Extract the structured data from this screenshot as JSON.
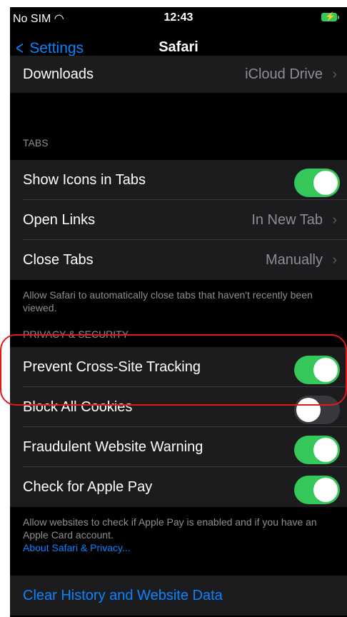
{
  "status": {
    "carrier": "No SIM",
    "time": "12:43"
  },
  "nav": {
    "back_label": "Settings",
    "title": "Safari"
  },
  "downloads": {
    "label": "Downloads",
    "value": "iCloud Drive"
  },
  "tabs_section": {
    "header": "TABS",
    "rows": [
      {
        "label": "Show Icons in Tabs"
      },
      {
        "label": "Open Links",
        "value": "In New Tab"
      },
      {
        "label": "Close Tabs",
        "value": "Manually"
      }
    ],
    "footer": "Allow Safari to automatically close tabs that haven't recently been viewed."
  },
  "privacy_section": {
    "header": "PRIVACY & SECURITY",
    "rows": [
      {
        "label": "Prevent Cross-Site Tracking",
        "on": true
      },
      {
        "label": "Block All Cookies",
        "on": false
      },
      {
        "label": "Fraudulent Website Warning",
        "on": true
      },
      {
        "label": "Check for Apple Pay",
        "on": true
      }
    ],
    "footer": "Allow websites to check if Apple Pay is enabled and if you have an Apple Card account.",
    "footer_link": "About Safari & Privacy..."
  },
  "clear_history_label": "Clear History and Website Data",
  "colors": {
    "accent": "#0a84ff",
    "toggle_on": "#35c759",
    "highlight": "#e01919"
  }
}
